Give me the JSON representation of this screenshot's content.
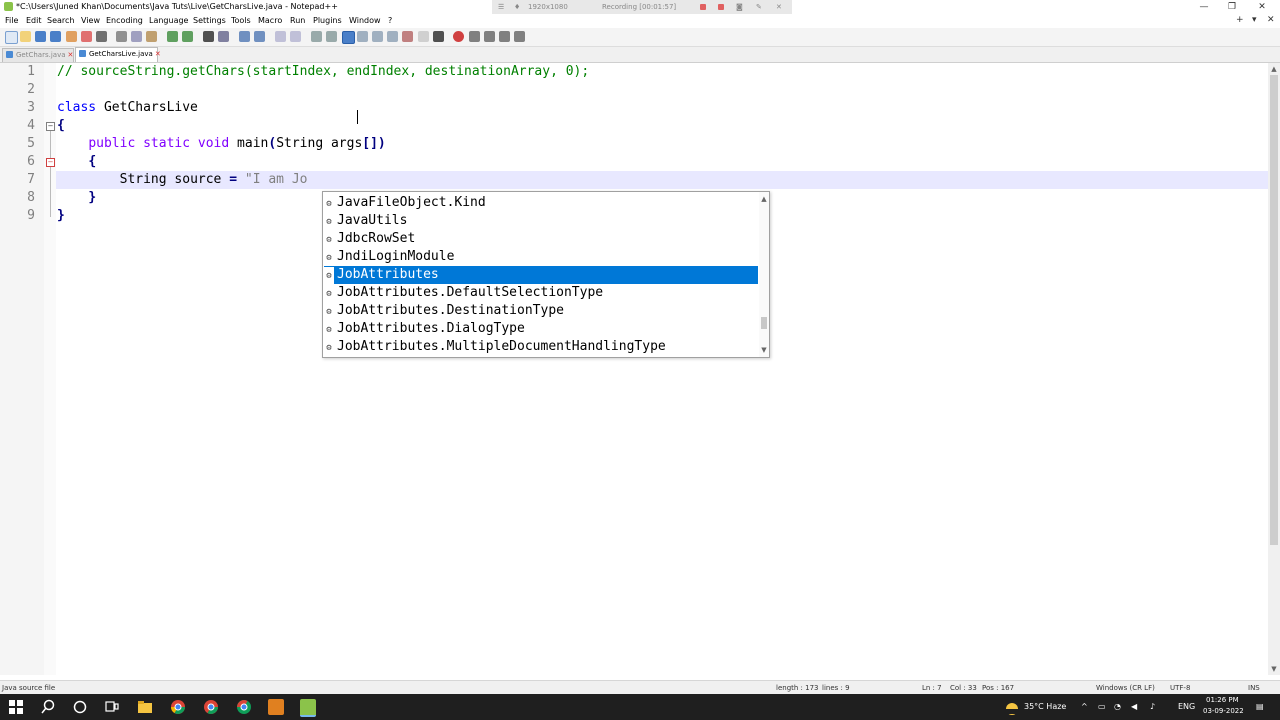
{
  "window": {
    "title": "*C:\\Users\\Juned Khan\\Documents\\Java Tuts\\Live\\GetCharsLive.java - Notepad++",
    "recording": {
      "resolution": "1920x1080",
      "label": "Recording [00:01:57]"
    }
  },
  "menu": [
    "File",
    "Edit",
    "Search",
    "View",
    "Encoding",
    "Language",
    "Settings",
    "Tools",
    "Macro",
    "Run",
    "Plugins",
    "Window",
    "?"
  ],
  "tabs": [
    {
      "label": "GetChars.java",
      "active": false
    },
    {
      "label": "GetCharsLive.java",
      "active": true
    }
  ],
  "editor": {
    "line_numbers": [
      "1",
      "2",
      "3",
      "4",
      "5",
      "6",
      "7",
      "8",
      "9"
    ],
    "lines": {
      "l1": "// sourceString.getChars(startIndex, endIndex, destinationArray, 0);",
      "l3_kw": "class",
      "l3_name": "GetCharsLive",
      "l4": "{",
      "l5_kw1": "public",
      "l5_kw2": "static",
      "l5_kw3": "void",
      "l5_rest": "main",
      "l5_paren1": "(",
      "l5_args": "String args",
      "l5_br": "[])",
      "l6": "{",
      "l7_type": "String",
      "l7_var": "source",
      "l7_eq": "=",
      "l7_str": "\"I am Jo",
      "l8": "}",
      "l9": "}"
    }
  },
  "autocomplete": {
    "items": [
      "JavaFileObject.Kind",
      "JavaUtils",
      "JdbcRowSet",
      "JndiLoginModule",
      "JobAttributes",
      "JobAttributes.DefaultSelectionType",
      "JobAttributes.DestinationType",
      "JobAttributes.DialogType",
      "JobAttributes.MultipleDocumentHandlingType"
    ],
    "selected_index": 4
  },
  "status": {
    "file_type": "Java source file",
    "length": "length : 173",
    "lines": "lines : 9",
    "ln": "Ln : 7",
    "col": "Col : 33",
    "pos": "Pos : 167",
    "eol": "Windows (CR LF)",
    "encoding": "UTF-8",
    "mode": "INS"
  },
  "taskbar": {
    "weather": "35°C  Haze",
    "lang": "ENG",
    "time": "01:26 PM",
    "date": "03-09-2022"
  },
  "colors": {
    "selection": "#0078d7",
    "comment": "#008000",
    "keyword": "#8000ff"
  }
}
